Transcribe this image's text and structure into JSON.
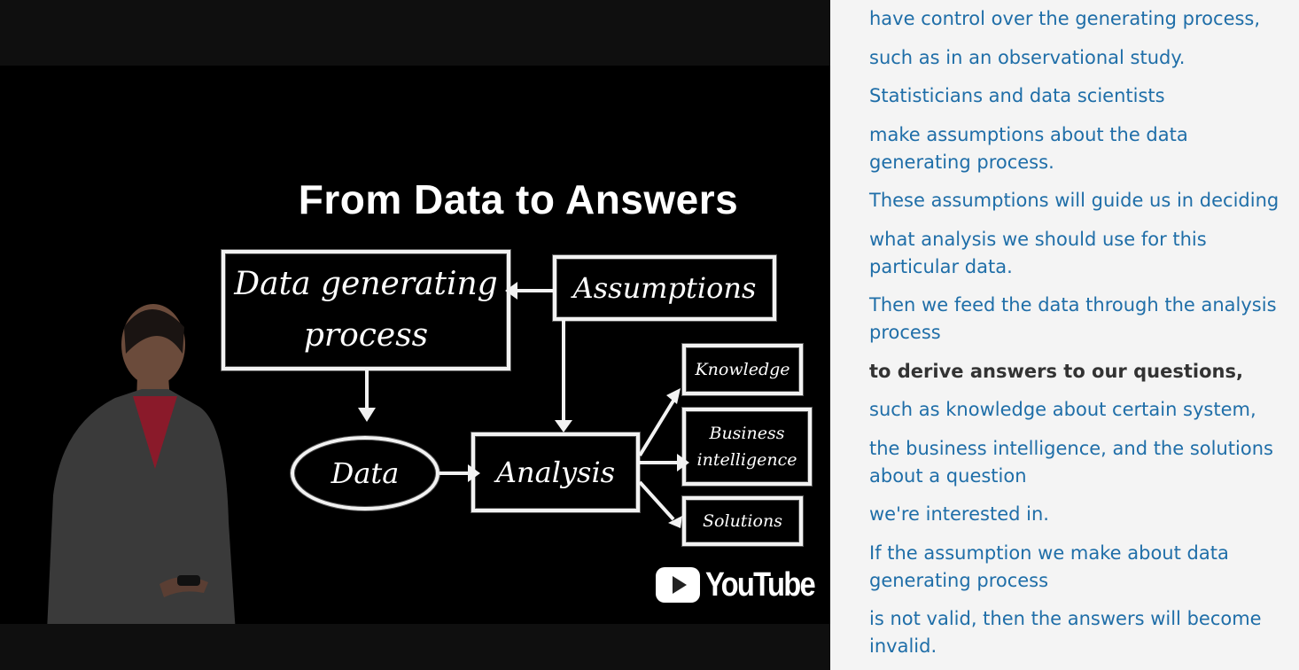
{
  "video": {
    "slide_title": "From Data to Answers",
    "diagram": {
      "data_generating_process_line1": "Data generating",
      "data_generating_process_line2": "process",
      "assumptions": "Assumptions",
      "data": "Data",
      "analysis": "Analysis",
      "knowledge": "Knowledge",
      "business_intelligence_line1": "Business",
      "business_intelligence_line2": "intelligence",
      "solutions": "Solutions"
    },
    "brand": "YouTube"
  },
  "transcript": {
    "lines": [
      {
        "text": "have control over the generating process,",
        "current": false
      },
      {
        "text": "such as in an observational study.",
        "current": false
      },
      {
        "text": "Statisticians and data scientists",
        "current": false
      },
      {
        "text": "make assumptions about the data generating process.",
        "current": false
      },
      {
        "text": "These assumptions will guide us in deciding",
        "current": false
      },
      {
        "text": "what analysis we should use for this particular data.",
        "current": false
      },
      {
        "text": "Then we feed the data through the analysis process",
        "current": false
      },
      {
        "text": "to derive answers to our questions,",
        "current": true
      },
      {
        "text": "such as knowledge about certain system,",
        "current": false
      },
      {
        "text": "the business intelligence, and the solutions about a question",
        "current": false
      },
      {
        "text": "we're interested in.",
        "current": false
      },
      {
        "text": "If the assumption we make about data generating process",
        "current": false
      },
      {
        "text": "is not valid, then the answers will become invalid.",
        "current": false
      }
    ]
  },
  "colors": {
    "transcript_link": "#1f6ea8",
    "transcript_current": "#333333",
    "transcript_bg": "#f4f4f4",
    "video_letterbox": "#0f0f0f"
  }
}
